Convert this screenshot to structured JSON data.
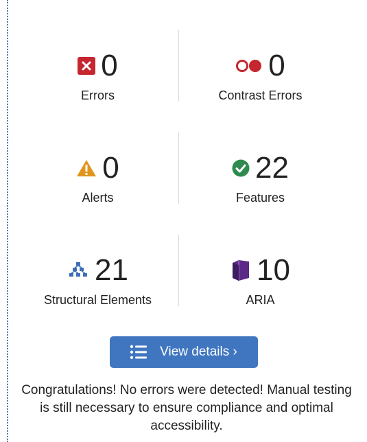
{
  "stats": {
    "errors": {
      "count": "0",
      "label": "Errors",
      "icon": "error-x-icon",
      "color": "#c5262f"
    },
    "contrast_errors": {
      "count": "0",
      "label": "Contrast Errors",
      "icon": "contrast-icon",
      "color": "#c5262f"
    },
    "alerts": {
      "count": "0",
      "label": "Alerts",
      "icon": "warning-triangle-icon",
      "color": "#e0951d"
    },
    "features": {
      "count": "22",
      "label": "Features",
      "icon": "check-circle-icon",
      "color": "#2e8a4e"
    },
    "structural": {
      "count": "21",
      "label": "Structural Elements",
      "icon": "hierarchy-icon",
      "color": "#3d6fb8"
    },
    "aria": {
      "count": "10",
      "label": "ARIA",
      "icon": "aria-cube-icon",
      "color": "#5c2a86"
    }
  },
  "button": {
    "label": "View details ›",
    "icon": "list-icon",
    "color": "#3f76bf"
  },
  "message": "Congratulations! No errors were detected! Manual testing is still necessary to ensure compliance and optimal accessibility."
}
